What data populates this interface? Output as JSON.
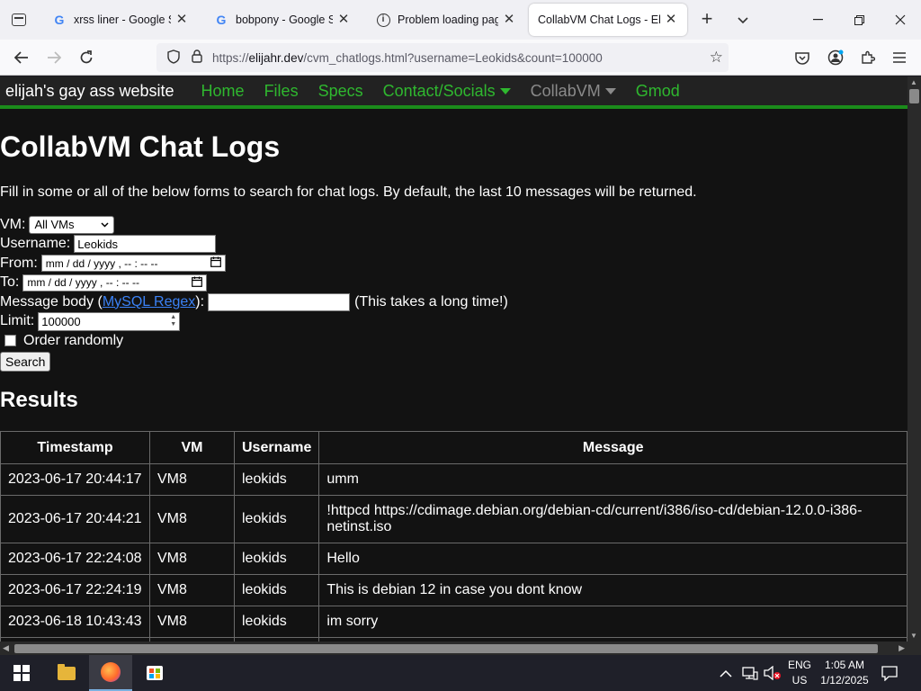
{
  "browser": {
    "tabs": [
      {
        "title": "xrss liner - Google Sear",
        "favicon": "google-icon",
        "active": false
      },
      {
        "title": "bobpony - Google Sear",
        "favicon": "google-icon",
        "active": false
      },
      {
        "title": "Problem loading page",
        "favicon": "info-icon",
        "active": false
      },
      {
        "title": "CollabVM Chat Logs - Elija",
        "favicon": "none",
        "active": true
      }
    ],
    "url_prefix": "https://",
    "url_host": "elijahr.dev",
    "url_path": "/cvm_chatlogs.html?username=Leokids&count=100000"
  },
  "site": {
    "brand": "elijah's gay ass website",
    "nav": [
      {
        "label": "Home",
        "dropdown": false,
        "dim": false
      },
      {
        "label": "Files",
        "dropdown": false,
        "dim": false
      },
      {
        "label": "Specs",
        "dropdown": false,
        "dim": false
      },
      {
        "label": "Contact/Socials",
        "dropdown": true,
        "dim": false
      },
      {
        "label": "CollabVM",
        "dropdown": true,
        "dim": true
      },
      {
        "label": "Gmod",
        "dropdown": false,
        "dim": false
      }
    ],
    "accent": "#2fb82f",
    "nav_border": "#1b8c1b"
  },
  "page": {
    "title": "CollabVM Chat Logs",
    "intro": "Fill in some or all of the below forms to search for chat logs. By default, the last 10 messages will be returned."
  },
  "form": {
    "vm_label": "VM:",
    "vm_value": "All VMs",
    "username_label": "Username:",
    "username_value": "Leokids",
    "from_label": "From:",
    "from_placeholder": "mm / dd / yyyy ,  -- : --  --",
    "to_label": "To:",
    "to_placeholder": "mm / dd / yyyy ,  -- : --  --",
    "message_label_pre": "Message body (",
    "message_link": "MySQL Regex",
    "message_label_post": "):",
    "message_value": "",
    "message_note": "(This takes a long time!)",
    "limit_label": "Limit:",
    "limit_value": "100000",
    "random_label": "Order randomly",
    "random_checked": false,
    "search_button": "Search"
  },
  "results": {
    "heading": "Results",
    "columns": [
      "Timestamp",
      "VM",
      "Username",
      "Message"
    ],
    "rows": [
      [
        "2023-06-17 20:44:17",
        "VM8",
        "leokids",
        "umm"
      ],
      [
        "2023-06-17 20:44:21",
        "VM8",
        "leokids",
        "!httpcd https://cdimage.debian.org/debian-cd/current/i386/iso-cd/debian-12.0.0-i386-netinst.iso"
      ],
      [
        "2023-06-17 22:24:08",
        "VM8",
        "leokids",
        "Hello"
      ],
      [
        "2023-06-17 22:24:19",
        "VM8",
        "leokids",
        "This is debian 12 in case you dont know"
      ],
      [
        "2023-06-18 10:43:43",
        "VM8",
        "leokids",
        "im sorry"
      ]
    ]
  },
  "taskbar": {
    "lang_top": "ENG",
    "lang_bottom": "US",
    "time": "1:05 AM",
    "date": "1/12/2025"
  }
}
